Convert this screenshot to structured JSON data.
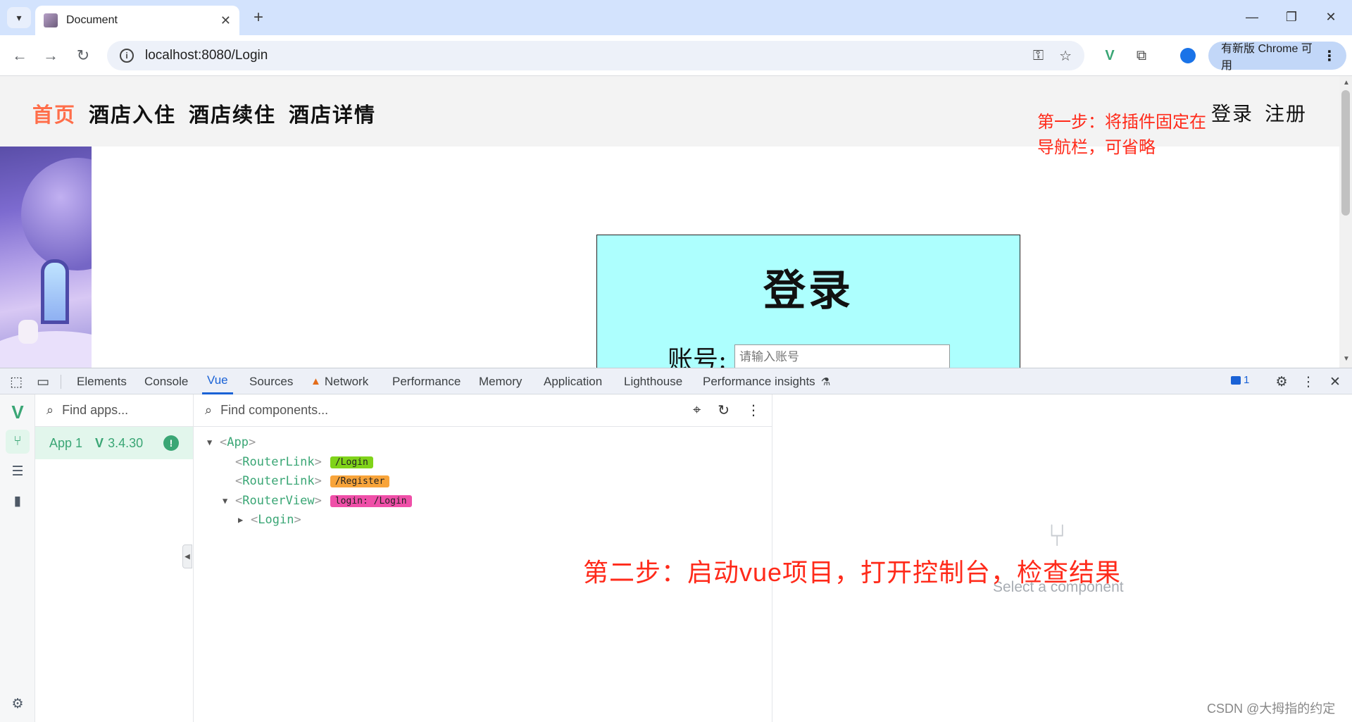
{
  "browser": {
    "tab_title": "Document",
    "tab_close": "✕",
    "new_tab": "+",
    "url": "localhost:8080/Login",
    "update_chip": "有新版 Chrome 可用",
    "window_controls": [
      "—",
      "❐",
      "✕"
    ]
  },
  "site": {
    "nav_items": [
      "首页",
      "酒店入住",
      "酒店续住",
      "酒店详情"
    ],
    "auth_items": [
      "登录",
      "注册"
    ],
    "annotation_step1": "第一步：将插件固定在导航栏，可省略",
    "login_title": "登录",
    "account_label": "账号:",
    "account_placeholder": "请输入账号"
  },
  "devtools": {
    "tabs": [
      "Elements",
      "Console",
      "Vue",
      "Sources",
      "Network",
      "Performance",
      "Memory",
      "Application",
      "Lighthouse",
      "Performance insights"
    ],
    "active_tab": "Vue",
    "message_count": "1",
    "apps_search_placeholder": "Find apps...",
    "app_name": "App 1",
    "vue_version": "3.4.30",
    "components_search_placeholder": "Find components...",
    "tree": [
      {
        "name": "App",
        "expanded": true,
        "chip": null
      },
      {
        "name": "RouterLink",
        "chip": "/Login",
        "chip_color": "green"
      },
      {
        "name": "RouterLink",
        "chip": "/Register",
        "chip_color": "orange"
      },
      {
        "name": "RouterView",
        "expanded": true,
        "chip": "login: /Login",
        "chip_color": "pink"
      },
      {
        "name": "Login",
        "expanded": false,
        "chip": null
      }
    ],
    "empty_state": "Select a component",
    "annotation_step2": "第二步：启动vue项目，打开控制台，检查结果"
  },
  "watermark": "CSDN @大拇指的约定",
  "colors": {
    "vue_green": "#3aa675",
    "annotation_red": "#ff2a1a",
    "nav_active": "#ff6e4a",
    "login_bg": "#adfffe"
  }
}
